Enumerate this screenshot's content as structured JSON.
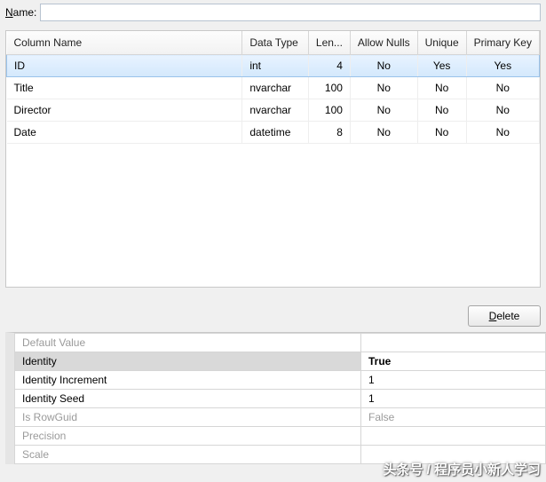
{
  "nameLabel_pre": "N",
  "nameLabel_rest": "ame:",
  "nameValue": "",
  "grid": {
    "headers": [
      "Column Name",
      "Data Type",
      "Len...",
      "Allow Nulls",
      "Unique",
      "Primary Key"
    ],
    "rows": [
      {
        "name": "ID",
        "type": "int",
        "len": "4",
        "nulls": "No",
        "unique": "Yes",
        "pk": "Yes",
        "selected": true
      },
      {
        "name": "Title",
        "type": "nvarchar",
        "len": "100",
        "nulls": "No",
        "unique": "No",
        "pk": "No",
        "selected": false
      },
      {
        "name": "Director",
        "type": "nvarchar",
        "len": "100",
        "nulls": "No",
        "unique": "No",
        "pk": "No",
        "selected": false
      },
      {
        "name": "Date",
        "type": "datetime",
        "len": "8",
        "nulls": "No",
        "unique": "No",
        "pk": "No",
        "selected": false
      }
    ]
  },
  "deleteBtn_pre": "D",
  "deleteBtn_rest": "elete",
  "props": [
    {
      "key": "Default Value",
      "val": "",
      "disabled": true,
      "sel": false
    },
    {
      "key": "Identity",
      "val": "True",
      "disabled": false,
      "sel": true
    },
    {
      "key": "Identity Increment",
      "val": "1",
      "disabled": false,
      "sel": false
    },
    {
      "key": "Identity Seed",
      "val": "1",
      "disabled": false,
      "sel": false
    },
    {
      "key": "Is RowGuid",
      "val": "False",
      "disabled": true,
      "sel": false
    },
    {
      "key": "Precision",
      "val": "",
      "disabled": true,
      "sel": false
    },
    {
      "key": "Scale",
      "val": "",
      "disabled": true,
      "sel": false
    }
  ],
  "watermark": "头条号 / 程序员小新人学习"
}
